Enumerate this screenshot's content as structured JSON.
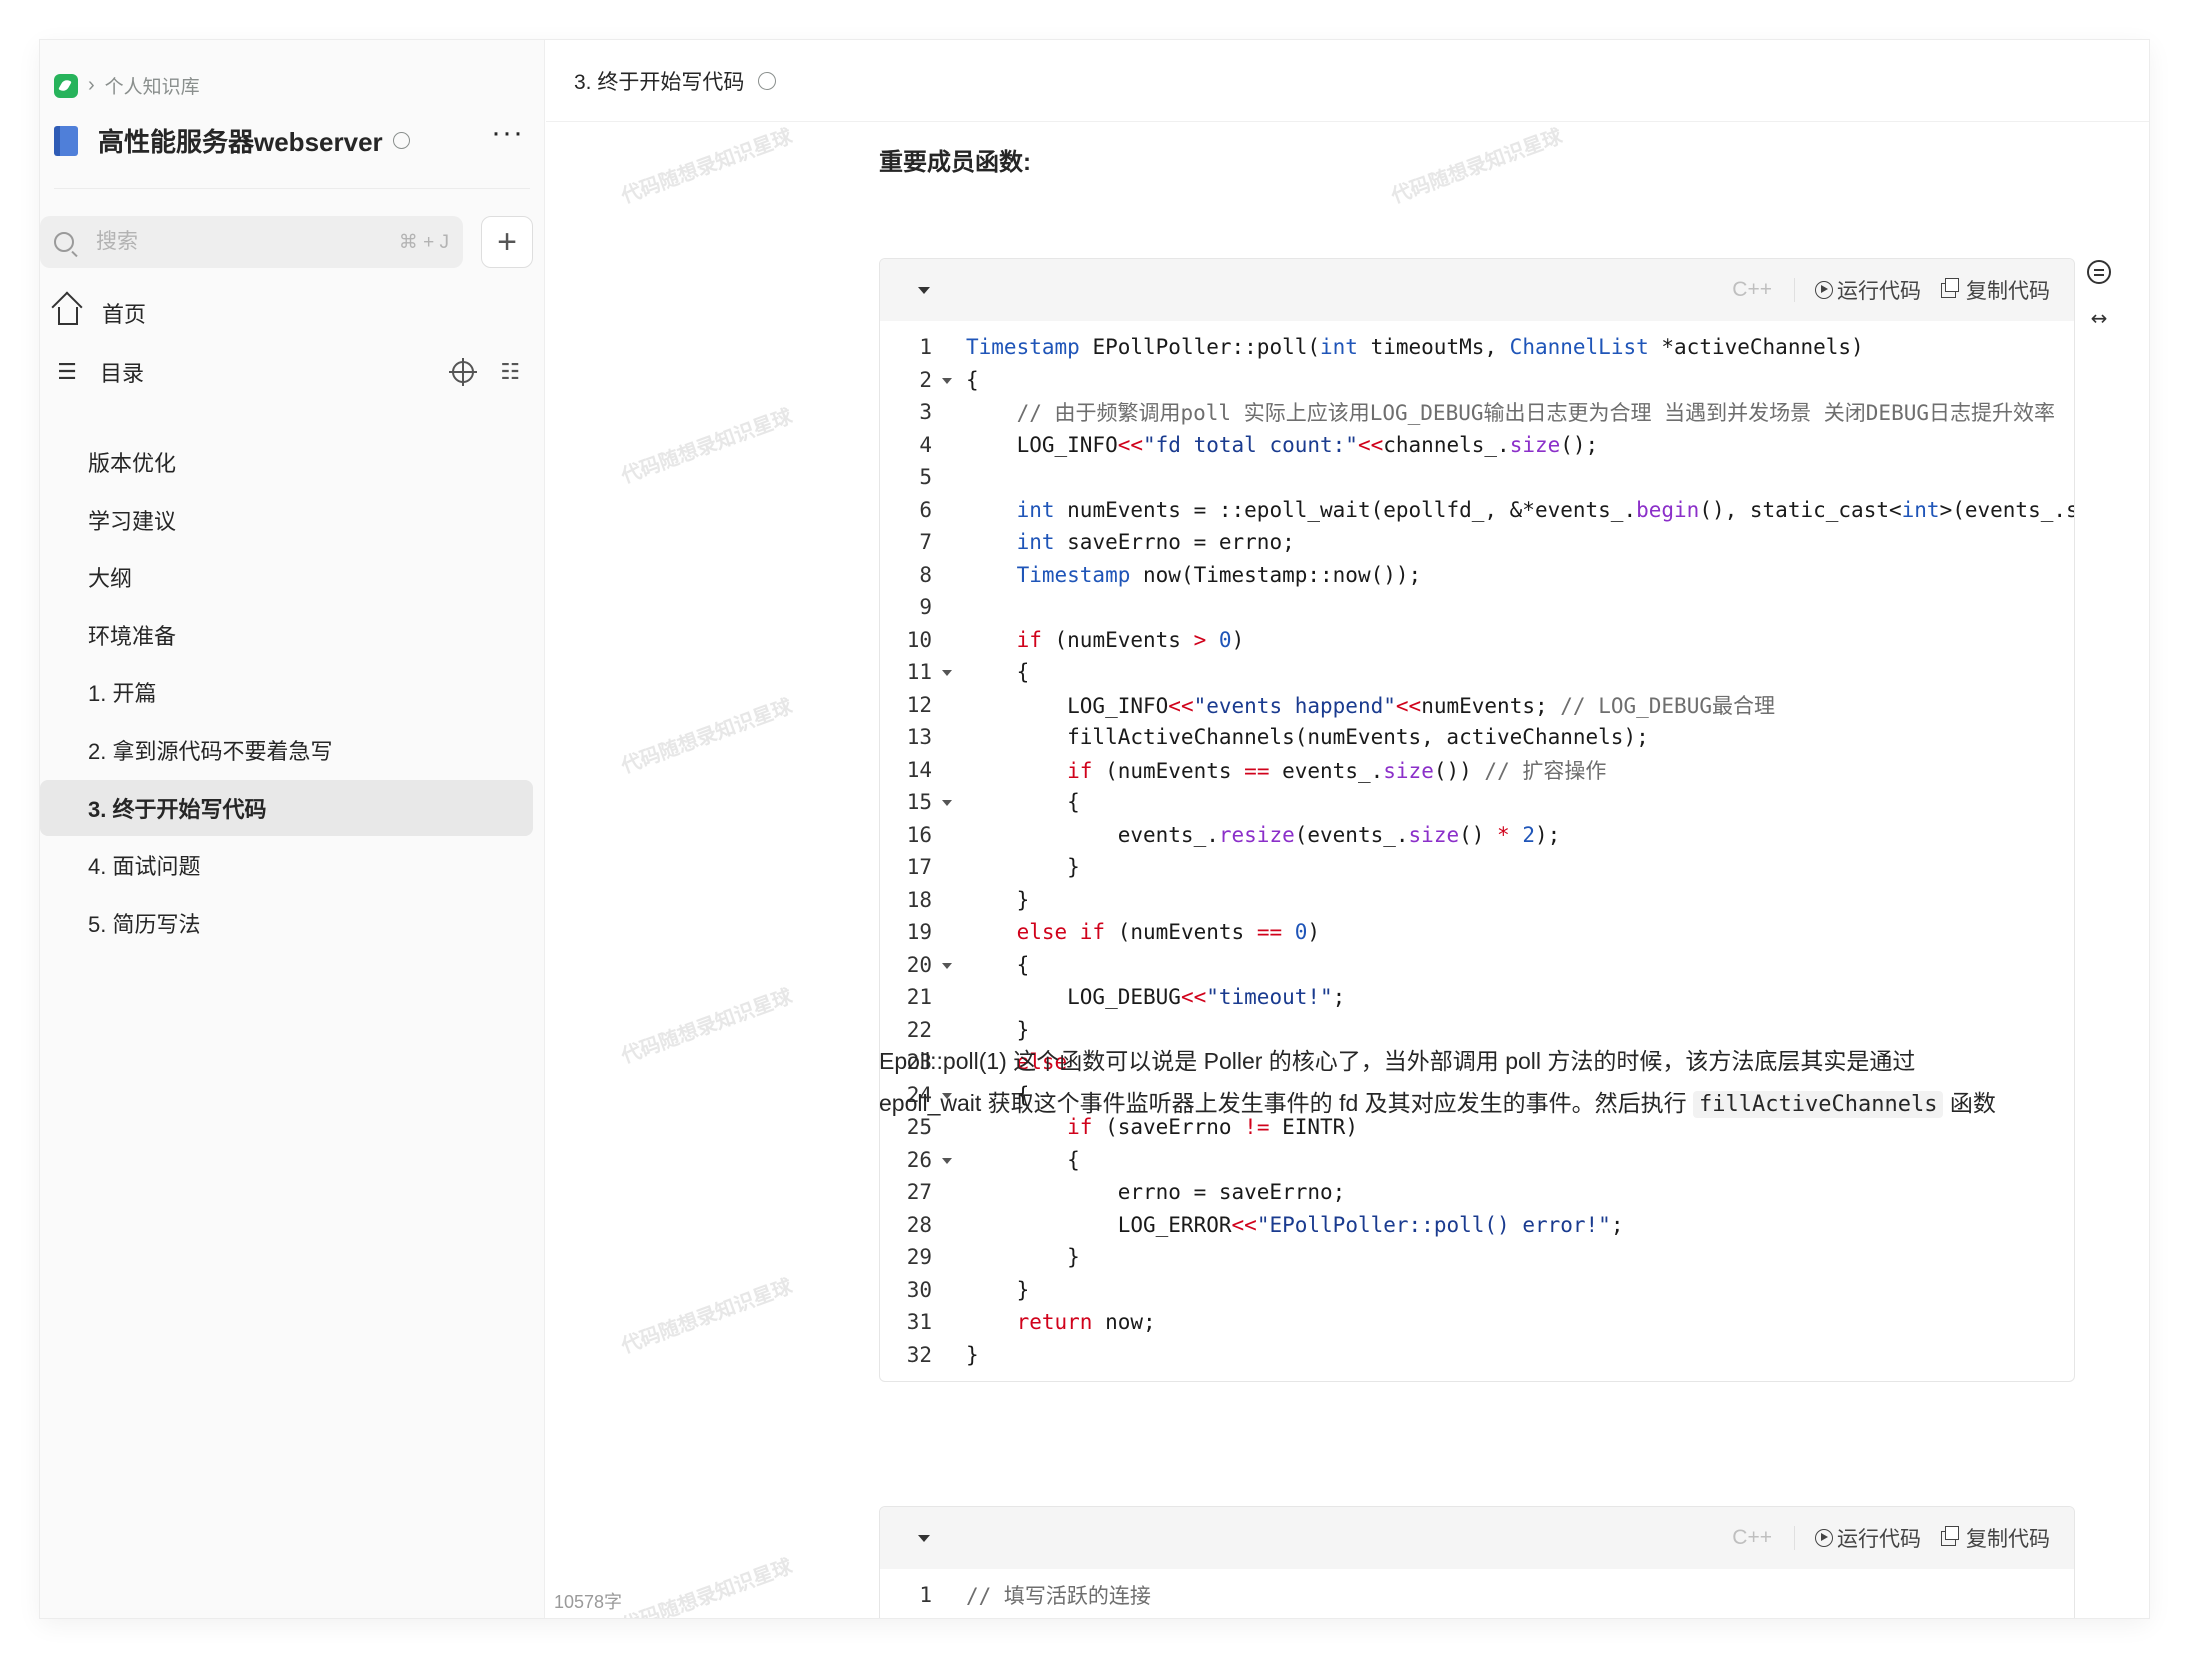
{
  "breadcrumb": {
    "root": "个人知识库"
  },
  "book": {
    "title": "高性能服务器webserver",
    "more": "···"
  },
  "search": {
    "placeholder": "搜索",
    "shortcut": "⌘ + J"
  },
  "add_label": "+",
  "nav": {
    "home": "首页",
    "toc": "目录"
  },
  "toc_items": [
    {
      "label": "版本优化"
    },
    {
      "label": "学习建议"
    },
    {
      "label": "大纲"
    },
    {
      "label": "环境准备"
    },
    {
      "label": "1. 开篇"
    },
    {
      "label": "2. 拿到源代码不要着急写"
    },
    {
      "label": "3. 终于开始写代码"
    },
    {
      "label": "4. 面试问题"
    },
    {
      "label": "5. 简历写法"
    }
  ],
  "doc": {
    "title": "3. 终于开始写代码",
    "section_title": "重要成员函数:",
    "watermark": "代码随想录知识星球",
    "word_count": "10578字"
  },
  "code_block_1": {
    "lang": "C++",
    "run_label": "运行代码",
    "copy_label": "复制代码",
    "lines": [
      {
        "n": "1",
        "fold": false,
        "html": "<span class=\"t\">Timestamp</span> EPollPoller::poll(<span class=\"t\">int</span> timeoutMs, <span class=\"t\">ChannelList</span> *activeChannels)"
      },
      {
        "n": "2",
        "fold": true,
        "html": "{"
      },
      {
        "n": "3",
        "fold": false,
        "html": "    <span class=\"c\">// 由于频繁调用poll 实际上应该用LOG_DEBUG输出日志更为合理 当遇到并发场景 关闭DEBUG日志提升效率</span>"
      },
      {
        "n": "4",
        "fold": false,
        "html": "    LOG_INFO<span class=\"k\">&lt;&lt;</span><span class=\"s\">\"fd total count:\"</span><span class=\"k\">&lt;&lt;</span>channels_.<span class=\"f\">size</span>();"
      },
      {
        "n": "5",
        "fold": false,
        "html": ""
      },
      {
        "n": "6",
        "fold": false,
        "html": "    <span class=\"t\">int</span> numEvents = ::epoll_wait(epollfd_, &amp;*events_.<span class=\"f\">begin</span>(), static_cast&lt;<span class=\"t\">int</span>&gt;(events_.size()), timeoutMs);"
      },
      {
        "n": "7",
        "fold": false,
        "html": "    <span class=\"t\">int</span> saveErrno = errno;"
      },
      {
        "n": "8",
        "fold": false,
        "html": "    <span class=\"t\">Timestamp</span> now(Timestamp::now());"
      },
      {
        "n": "9",
        "fold": false,
        "html": ""
      },
      {
        "n": "10",
        "fold": false,
        "html": "    <span class=\"k\">if</span> (numEvents <span class=\"k\">&gt;</span> <span class=\"n\">0</span>)"
      },
      {
        "n": "11",
        "fold": true,
        "html": "    {"
      },
      {
        "n": "12",
        "fold": false,
        "html": "        LOG_INFO<span class=\"k\">&lt;&lt;</span><span class=\"s\">\"events happend\"</span><span class=\"k\">&lt;&lt;</span>numEvents; <span class=\"c\">// LOG_DEBUG最合理</span>"
      },
      {
        "n": "13",
        "fold": false,
        "html": "        fillActiveChannels(numEvents, activeChannels);"
      },
      {
        "n": "14",
        "fold": false,
        "html": "        <span class=\"k\">if</span> (numEvents <span class=\"k\">==</span> events_.<span class=\"f\">size</span>()) <span class=\"c\">// 扩容操作</span>"
      },
      {
        "n": "15",
        "fold": true,
        "html": "        {"
      },
      {
        "n": "16",
        "fold": false,
        "html": "            events_.<span class=\"f\">resize</span>(events_.<span class=\"f\">size</span>() <span class=\"k\">*</span> <span class=\"n\">2</span>);"
      },
      {
        "n": "17",
        "fold": false,
        "html": "        }"
      },
      {
        "n": "18",
        "fold": false,
        "html": "    }"
      },
      {
        "n": "19",
        "fold": false,
        "html": "    <span class=\"k\">else if</span> (numEvents <span class=\"k\">==</span> <span class=\"n\">0</span>)"
      },
      {
        "n": "20",
        "fold": true,
        "html": "    {"
      },
      {
        "n": "21",
        "fold": false,
        "html": "        LOG_DEBUG<span class=\"k\">&lt;&lt;</span><span class=\"s\">\"timeout!\"</span>;"
      },
      {
        "n": "22",
        "fold": false,
        "html": "    }"
      },
      {
        "n": "23",
        "fold": false,
        "html": "    <span class=\"k\">else</span>"
      },
      {
        "n": "24",
        "fold": true,
        "html": "    {"
      },
      {
        "n": "25",
        "fold": false,
        "html": "        <span class=\"k\">if</span> (saveErrno <span class=\"k\">!=</span> EINTR)"
      },
      {
        "n": "26",
        "fold": true,
        "html": "        {"
      },
      {
        "n": "27",
        "fold": false,
        "html": "            errno = saveErrno;"
      },
      {
        "n": "28",
        "fold": false,
        "html": "            LOG_ERROR<span class=\"k\">&lt;&lt;</span><span class=\"s\">\"EPollPoller::poll() error!\"</span>;"
      },
      {
        "n": "29",
        "fold": false,
        "html": "        }"
      },
      {
        "n": "30",
        "fold": false,
        "html": "    }"
      },
      {
        "n": "31",
        "fold": false,
        "html": "    <span class=\"k\">return</span> now;"
      },
      {
        "n": "32",
        "fold": false,
        "html": "}"
      }
    ]
  },
  "paragraph": {
    "line1": "Epoll::poll(1) 这个函数可以说是 Poller 的核心了，当外部调用 poll 方法的时候，该方法底层其实是通过",
    "line2_prefix": "epoll_wait 获取这个事件监听器上发生事件的 fd 及其对应发生的事件。然后执行 ",
    "inline_code": "fillActiveChannels",
    "line2_suffix": " 函数"
  },
  "code_block_2": {
    "lang": "C++",
    "run_label": "运行代码",
    "copy_label": "复制代码",
    "lines": [
      {
        "n": "1",
        "fold": false,
        "html": "<span class=\"c\">// 填写活跃的连接</span>"
      }
    ]
  }
}
